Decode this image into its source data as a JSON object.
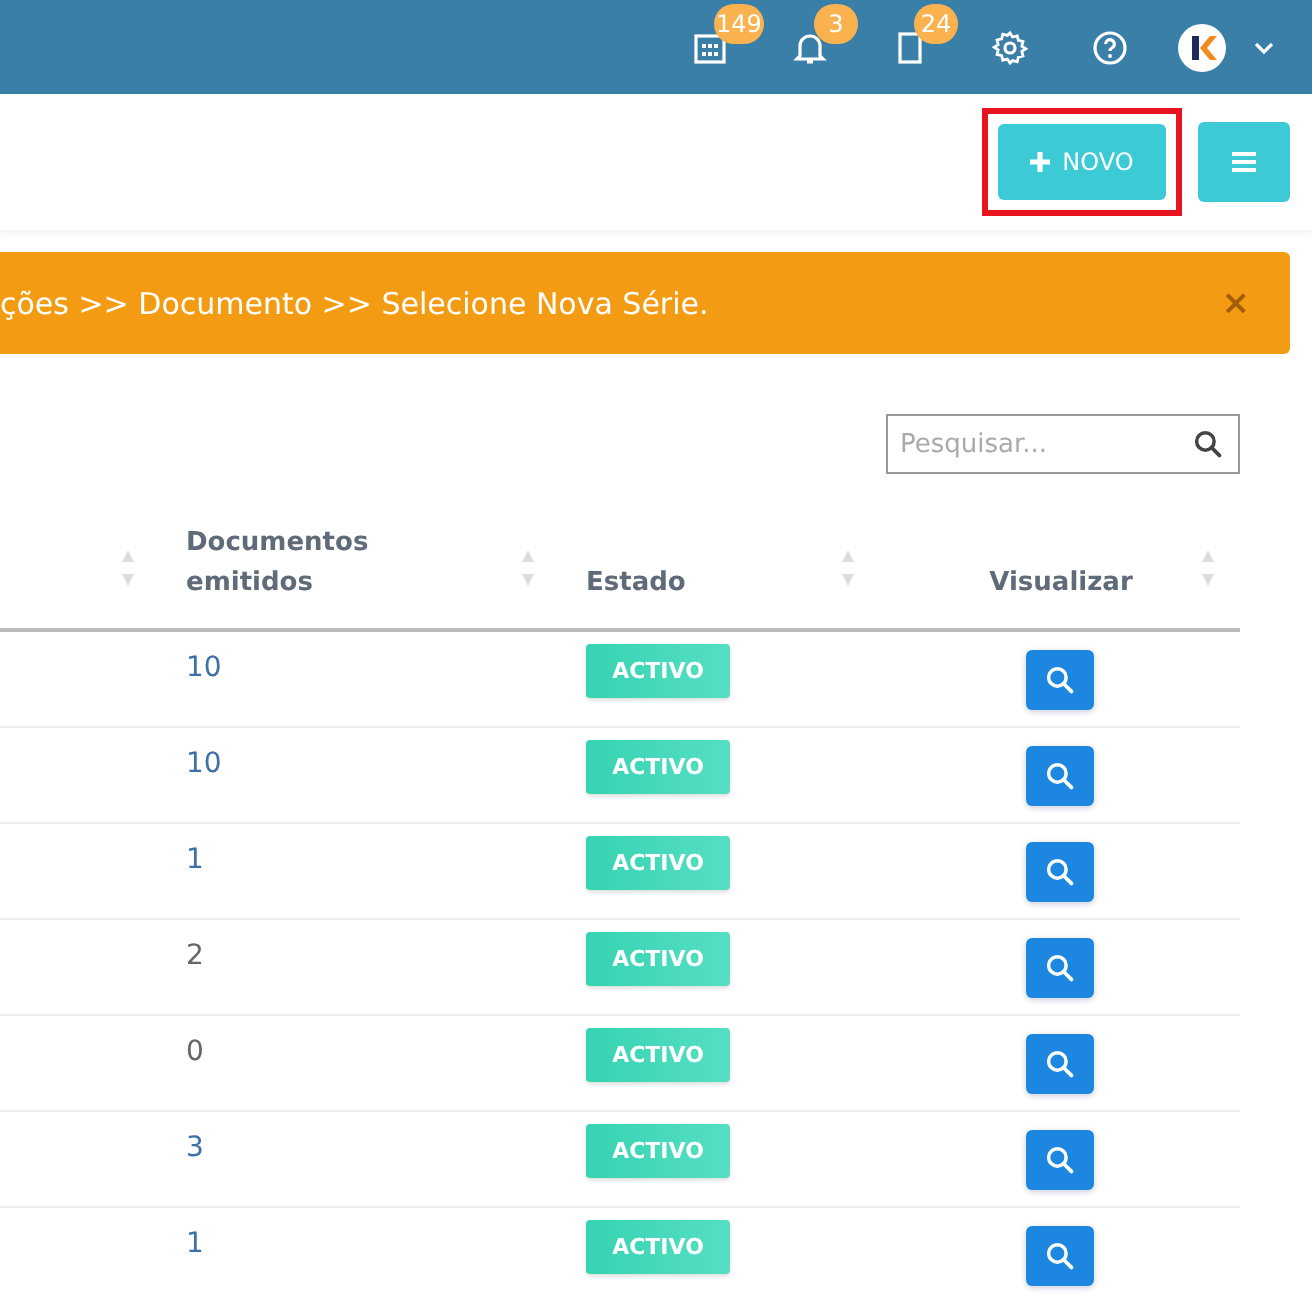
{
  "header": {
    "badges": [
      {
        "kind": "calendar",
        "count": "149"
      },
      {
        "kind": "bell",
        "count": "3"
      },
      {
        "kind": "document",
        "count": "24"
      }
    ]
  },
  "toolbar": {
    "new_button": {
      "label": "NOVO",
      "highlighted": true
    }
  },
  "alert": {
    "text": "ções >> Documento >> Selecione Nova Série.",
    "close": "×"
  },
  "search": {
    "placeholder": "Pesquisar..."
  },
  "table": {
    "columns": [
      {
        "sortable": true
      },
      {
        "label": "Documentos emitidos",
        "sortable": true
      },
      {
        "label": "Estado",
        "sortable": true
      },
      {
        "label": "Visualizar",
        "sortable": true
      }
    ],
    "rows": [
      {
        "count": "10",
        "link": true,
        "status": "ACTIVO"
      },
      {
        "count": "10",
        "link": true,
        "status": "ACTIVO"
      },
      {
        "count": "1",
        "link": true,
        "status": "ACTIVO"
      },
      {
        "count": "2",
        "link": false,
        "status": "ACTIVO"
      },
      {
        "count": "0",
        "link": false,
        "status": "ACTIVO"
      },
      {
        "count": "3",
        "link": true,
        "status": "ACTIVO"
      },
      {
        "count": "1",
        "link": true,
        "status": "ACTIVO"
      }
    ]
  }
}
